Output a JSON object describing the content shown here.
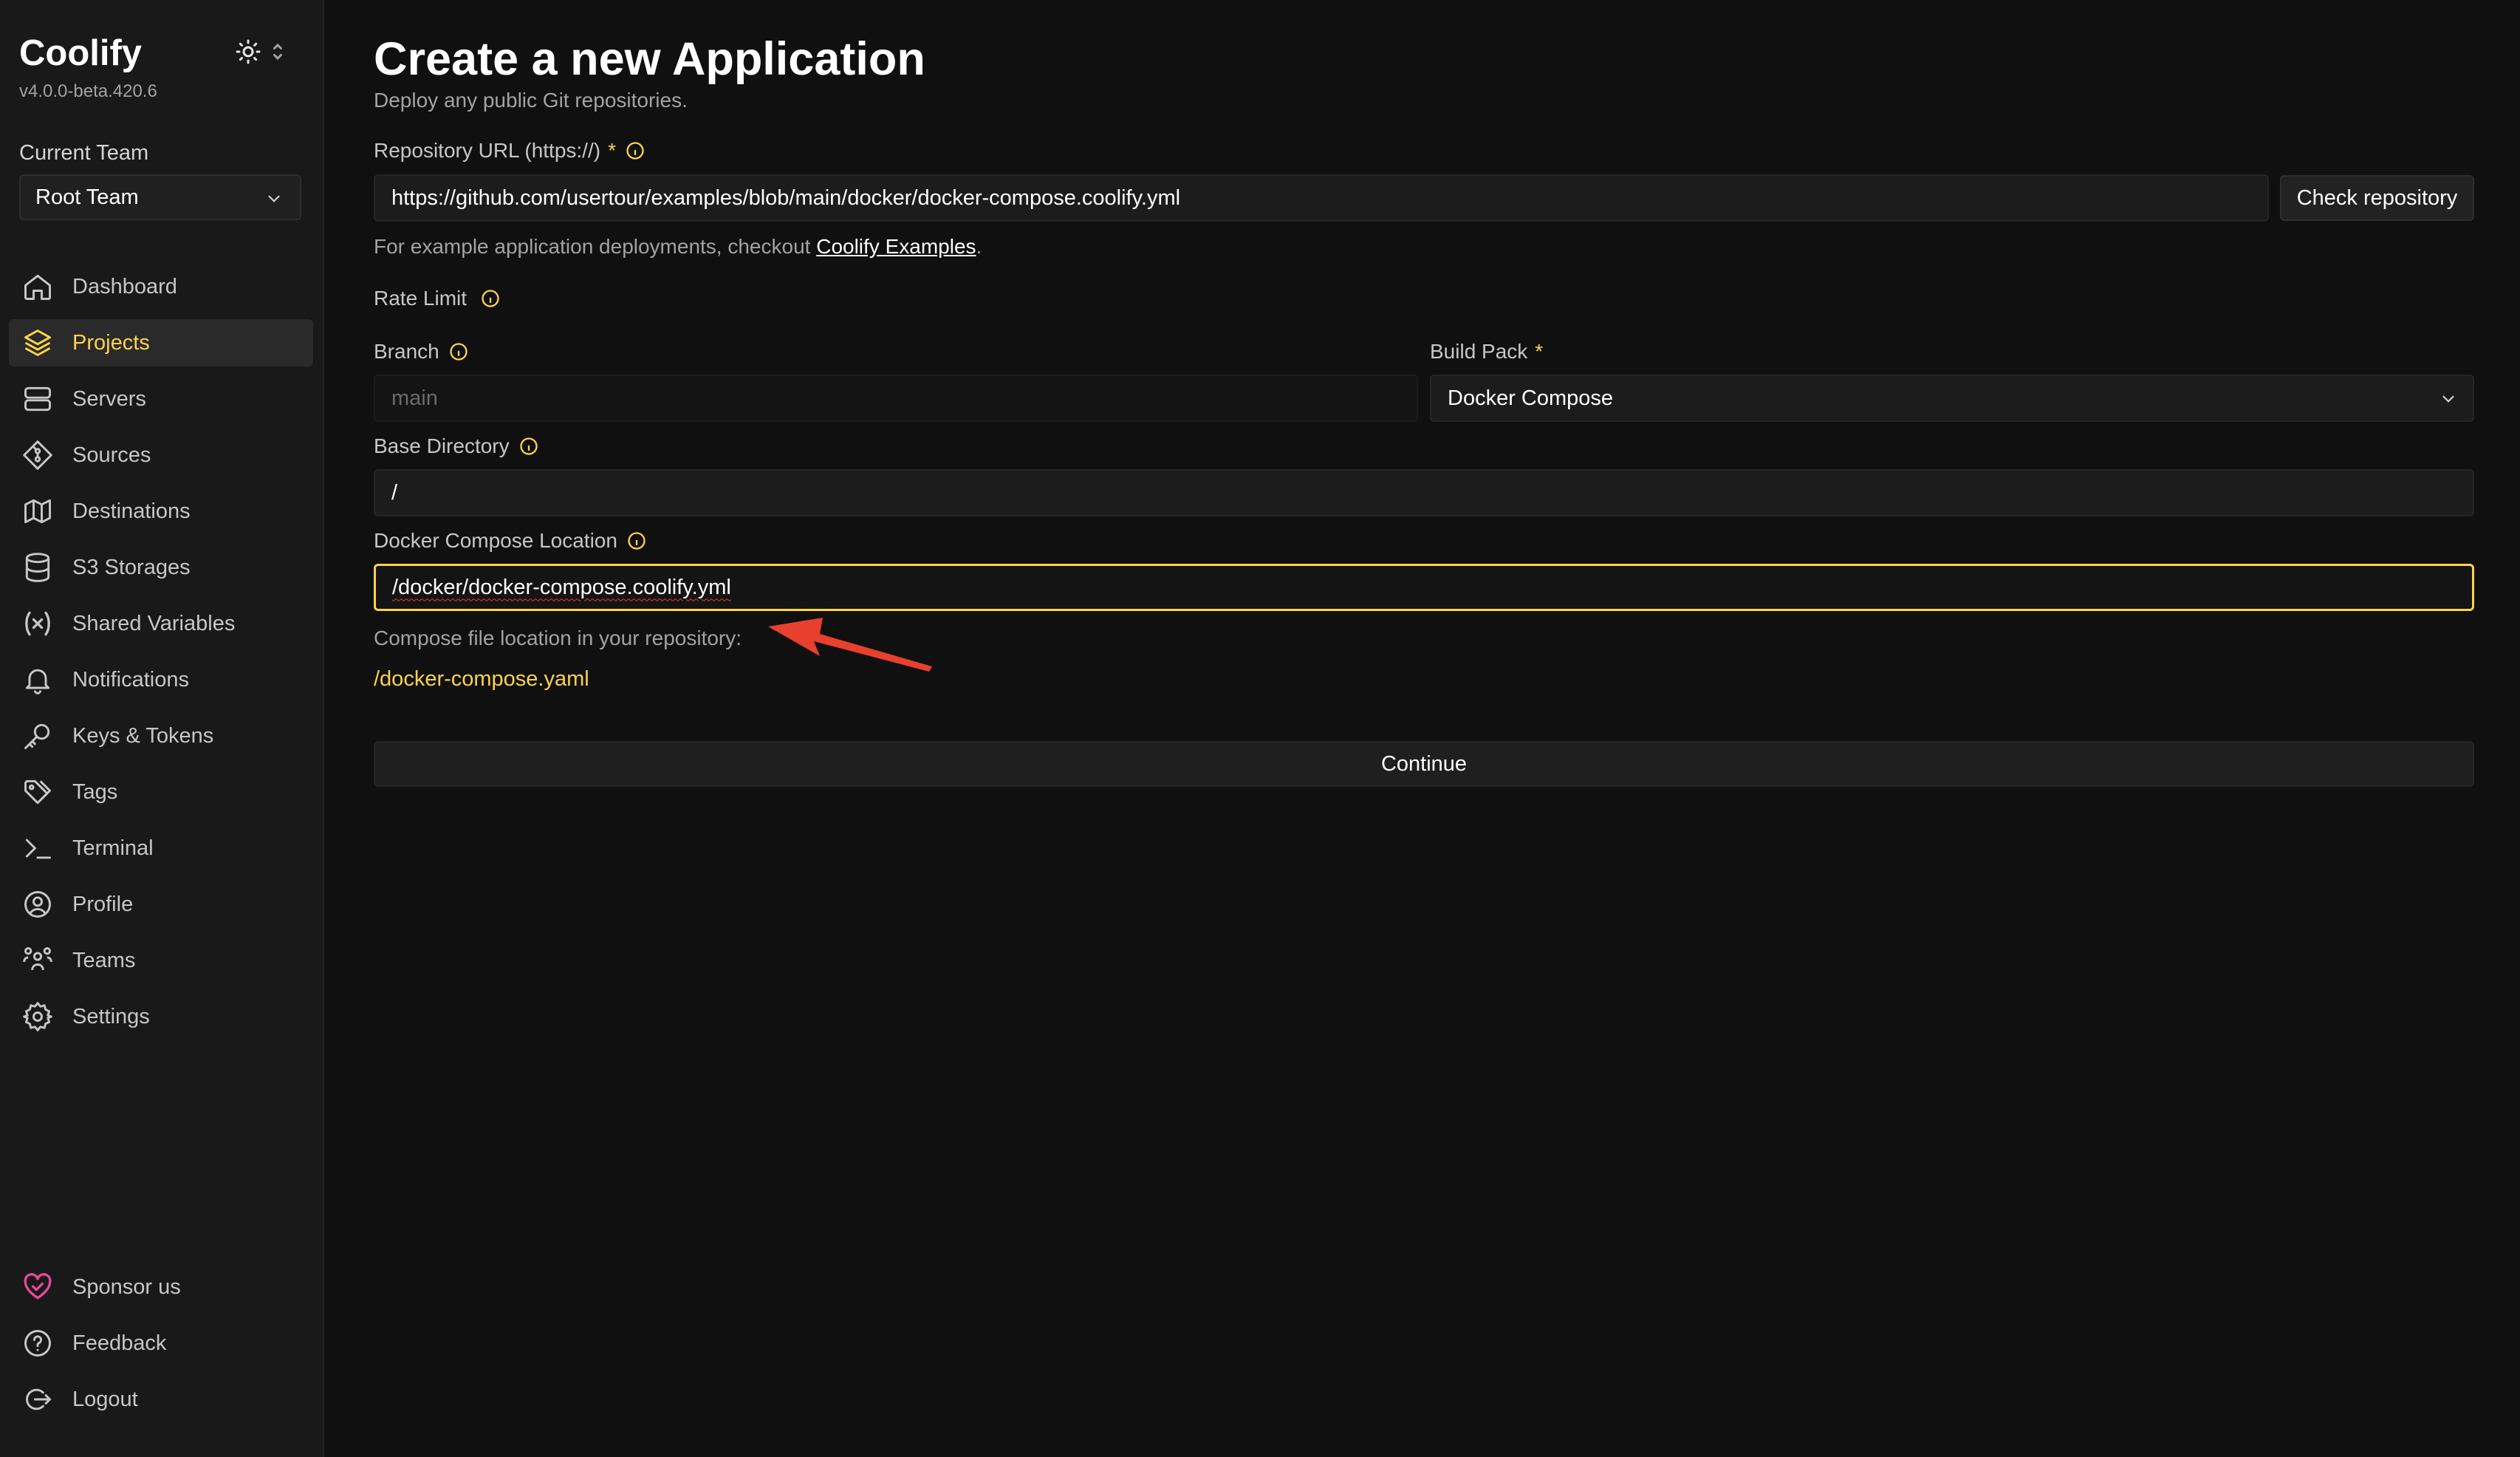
{
  "app": {
    "name": "Coolify",
    "version": "v4.0.0-beta.420.6"
  },
  "team": {
    "label": "Current Team",
    "selected": "Root Team"
  },
  "nav": {
    "items": [
      {
        "label": "Dashboard",
        "icon": "home-icon"
      },
      {
        "label": "Projects",
        "icon": "layers-icon",
        "active": true
      },
      {
        "label": "Servers",
        "icon": "server-icon"
      },
      {
        "label": "Sources",
        "icon": "git-icon"
      },
      {
        "label": "Destinations",
        "icon": "network-icon"
      },
      {
        "label": "S3 Storages",
        "icon": "database-icon"
      },
      {
        "label": "Shared Variables",
        "icon": "variable-icon"
      },
      {
        "label": "Notifications",
        "icon": "bell-icon"
      },
      {
        "label": "Keys & Tokens",
        "icon": "key-icon"
      },
      {
        "label": "Tags",
        "icon": "tag-icon"
      },
      {
        "label": "Terminal",
        "icon": "terminal-icon"
      },
      {
        "label": "Profile",
        "icon": "user-circle-icon"
      },
      {
        "label": "Teams",
        "icon": "users-icon"
      },
      {
        "label": "Settings",
        "icon": "gear-icon"
      }
    ],
    "bottom": [
      {
        "label": "Sponsor us",
        "icon": "heart-icon"
      },
      {
        "label": "Feedback",
        "icon": "help-circle-icon"
      },
      {
        "label": "Logout",
        "icon": "logout-icon"
      }
    ]
  },
  "page": {
    "title": "Create a new Application",
    "subtitle": "Deploy any public Git repositories."
  },
  "form": {
    "repo_url_label": "Repository URL (https://)",
    "repo_url_value": "https://github.com/usertour/examples/blob/main/docker/docker-compose.coolify.yml",
    "check_button": "Check repository",
    "examples_prefix": "For example application deployments, checkout ",
    "examples_link": "Coolify Examples",
    "examples_suffix": ".",
    "rate_limit_label": "Rate Limit",
    "branch_label": "Branch",
    "branch_value": "main",
    "build_pack_label": "Build Pack",
    "build_pack_value": "Docker Compose",
    "base_dir_label": "Base Directory",
    "base_dir_value": "/",
    "compose_loc_label": "Docker Compose Location",
    "compose_loc_value": "/docker/docker-compose.coolify.yml",
    "compose_hint": "Compose file location in your repository:",
    "compose_hint_path": "/docker-compose.yaml",
    "continue_button": "Continue",
    "required_mark": "*"
  },
  "colors": {
    "accent": "#fcd34d",
    "annotation_arrow": "#e8402f",
    "background": "#101010",
    "sidebar": "#191919"
  }
}
